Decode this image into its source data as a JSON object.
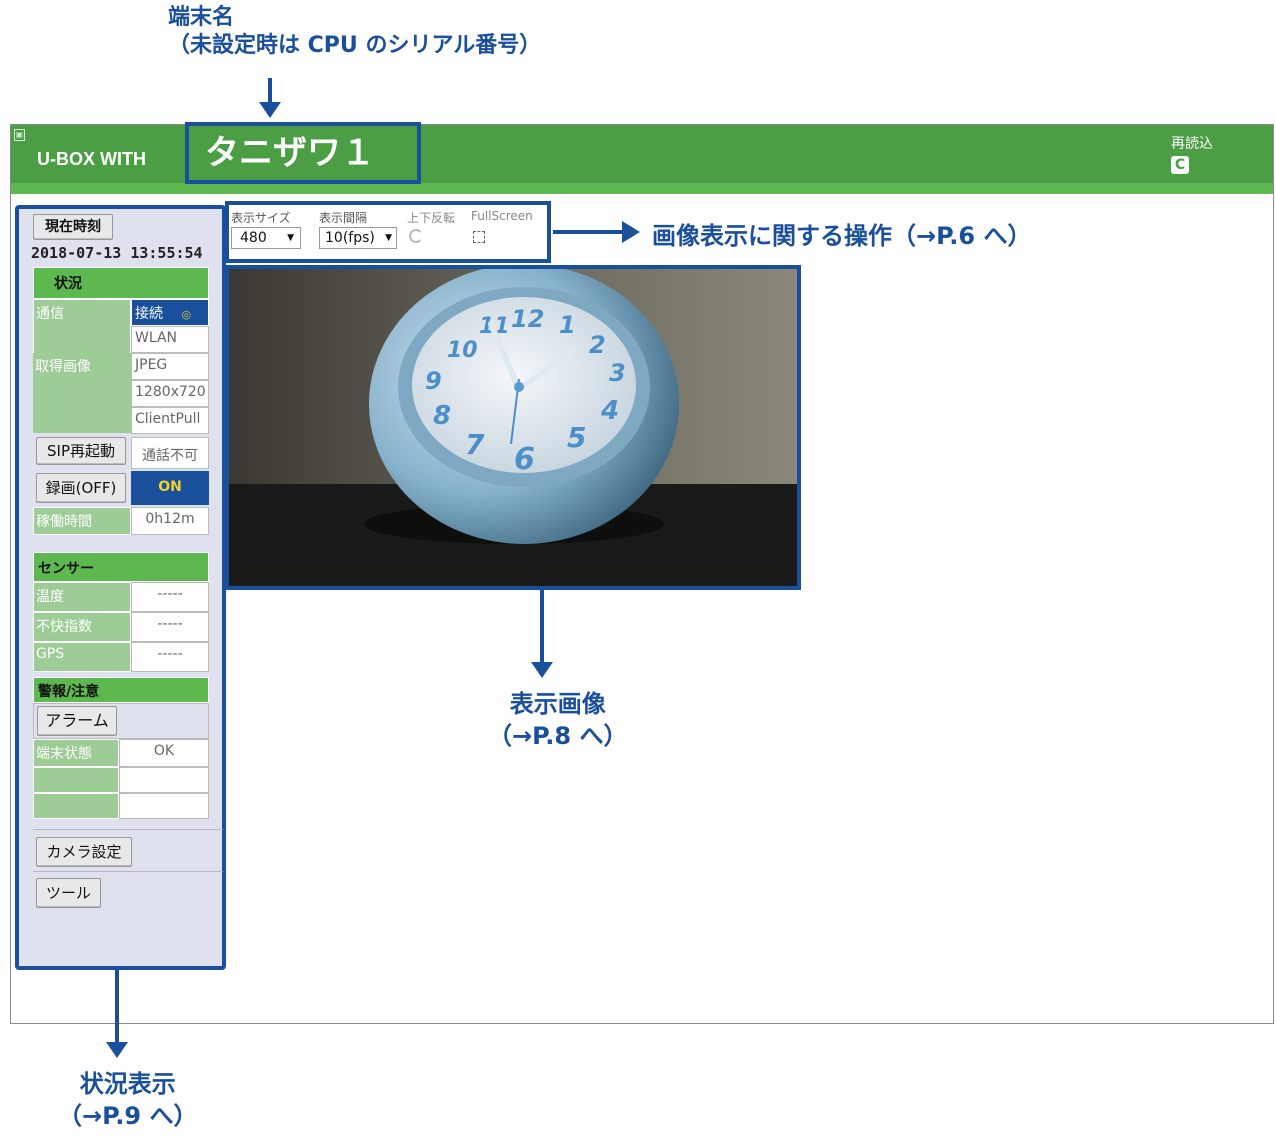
{
  "annotations": {
    "terminal_name_line1": "端末名",
    "terminal_name_line2": "（未設定時は CPU のシリアル番号）",
    "controls": "画像表示に関する操作（→P.6 へ）",
    "display_line1": "表示画像",
    "display_line2": "（→P.8 へ）",
    "status_line1": "状況表示",
    "status_line2": "（→P.9 へ）"
  },
  "header": {
    "brand": "U-BOX WITH",
    "terminal_name": "タニザワ１",
    "reload_label": "再読込",
    "reload_icon": "reload-icon",
    "corner_icon": "corner-icon",
    "colors": {
      "header_green": "#4c9e45",
      "accent_blue": "#1a4f9c"
    }
  },
  "sidebar": {
    "time_button": "現在時刻",
    "datetime": "2018-07-13 13:55:54",
    "status_header": "状況",
    "comm_label": "通信",
    "comm_value": "接続",
    "comm_icon": "◎",
    "wlan": "WLAN",
    "image_label": "取得画像",
    "image_format": "JPEG",
    "image_res": "1280x720",
    "image_mode": "ClientPull",
    "sip_button": "SIP再起動",
    "call_status": "通話不可",
    "record_button": "録画(OFF)",
    "record_state": "ON",
    "uptime_label": "稼働時間",
    "uptime_value": "0h12m",
    "sensor_header": "センサー",
    "temp_label": "温度",
    "temp_value": "-----",
    "discomfort_label": "不快指数",
    "discomfort_value": "-----",
    "gps_label": "GPS",
    "gps_value": "-----",
    "alert_header": "警報/注意",
    "alarm_button": "アラーム",
    "terminal_state_label": "端末状態",
    "terminal_state_value": "OK",
    "camera_settings_button": "カメラ設定",
    "tools_button": "ツール"
  },
  "controls": {
    "size_label": "表示サイズ",
    "size_value": "480",
    "interval_label": "表示間隔",
    "interval_value": "10(fps)",
    "flip_label": "上下反転",
    "fullscreen_label": "FullScreen",
    "dropdown_arrow": "▼",
    "rotate_icon": "rotate-icon",
    "fullscreen_icon": "fullscreen-icon"
  },
  "video": {
    "clock_numbers": [
      "12",
      "1",
      "2",
      "3",
      "4",
      "5",
      "6",
      "7",
      "8",
      "9",
      "10",
      "11"
    ]
  }
}
